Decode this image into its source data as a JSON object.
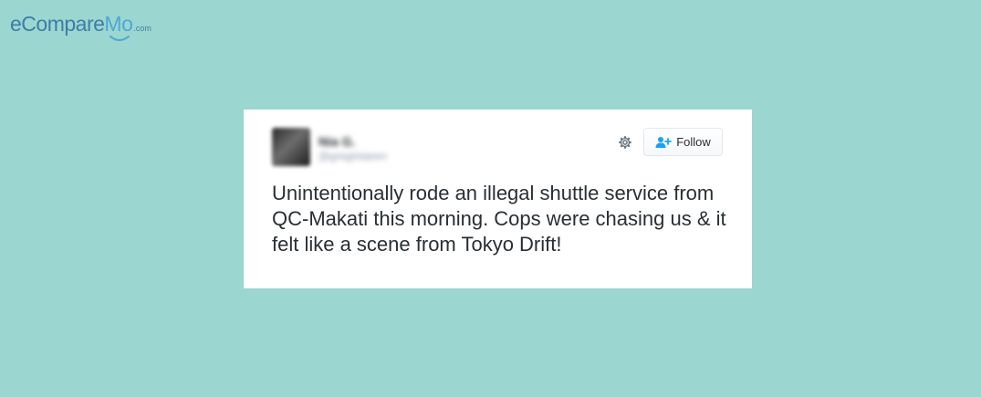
{
  "logo": {
    "part_e": "e",
    "part_compare": "Compare",
    "part_mo": "Mo",
    "part_dotcom": ".com"
  },
  "tweet": {
    "user_name": "Nia G.",
    "user_handle": "@greginiaeen",
    "follow_label": "Follow",
    "text": "Unintentionally rode an illegal shuttle service from QC-Makati this morning. Cops were chasing us & it felt like a scene from Tokyo Drift!",
    "icons": {
      "settings": "gear-icon",
      "follow": "add-user-icon"
    }
  },
  "colors": {
    "background": "#9bd6d0",
    "card": "#ffffff",
    "text": "#292f33",
    "accent": "#1da1f2",
    "logo_dark": "#3d7ea6",
    "logo_light": "#4ea8d4"
  }
}
